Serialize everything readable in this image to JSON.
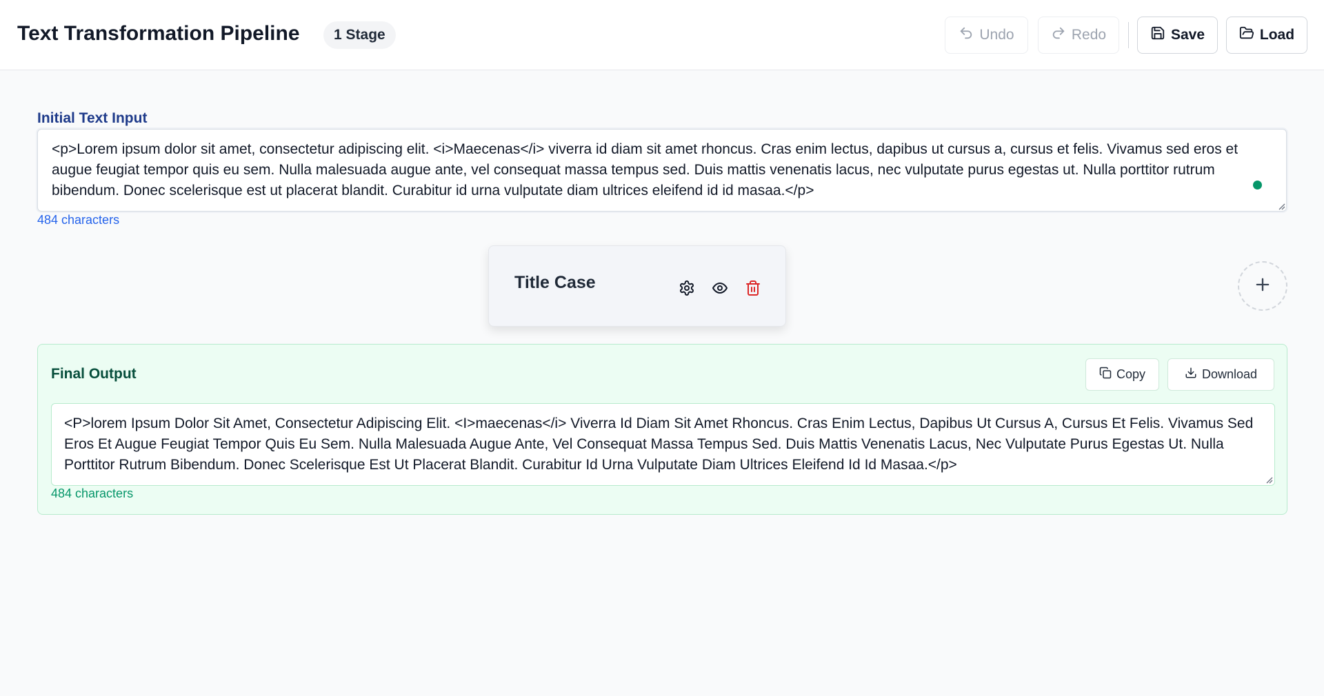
{
  "header": {
    "title": "Text Transformation Pipeline",
    "stage_badge": "1 Stage",
    "undo_label": "Undo",
    "redo_label": "Redo",
    "save_label": "Save",
    "load_label": "Load"
  },
  "input": {
    "label": "Initial Text Input",
    "value": "<p>Lorem ipsum dolor sit amet, consectetur adipiscing elit. <i>Maecenas</i> viverra id diam sit amet rhoncus. Cras enim lectus, dapibus ut cursus a, cursus et felis. Vivamus sed eros et augue feugiat tempor quis eu sem. Nulla malesuada augue ante, vel consequat massa tempus sed. Duis mattis venenatis lacus, nec vulputate purus egestas ut. Nulla porttitor rutrum bibendum. Donec scelerisque est ut placerat blandit. Curabitur id urna vulputate diam ultrices eleifend id id masaa.</p>",
    "char_count": "484 characters"
  },
  "stages": [
    {
      "title": "Title Case",
      "icons": [
        "gear-icon",
        "eye-icon",
        "trash-icon"
      ]
    }
  ],
  "output": {
    "title": "Final Output",
    "copy_label": "Copy",
    "download_label": "Download",
    "value": "<P>lorem Ipsum Dolor Sit Amet, Consectetur Adipiscing Elit. <I>maecenas</i> Viverra Id Diam Sit Amet Rhoncus. Cras Enim Lectus, Dapibus Ut Cursus A, Cursus Et Felis. Vivamus Sed Eros Et Augue Feugiat Tempor Quis Eu Sem. Nulla Malesuada Augue Ante, Vel Consequat Massa Tempus Sed. Duis Mattis Venenatis Lacus, Nec Vulputate Purus Egestas Ut. Nulla Porttitor Rutrum Bibendum. Donec Scelerisque Est Ut Placerat Blandit. Curabitur Id Urna Vulputate Diam Ultrices Eleifend Id Id Masaa.</p>",
    "char_count": "484 characters"
  },
  "colors": {
    "input_label": "#1e3a8a",
    "input_count": "#2563eb",
    "output_bg": "#ecfdf3",
    "output_title": "#064e3b",
    "output_count": "#059669",
    "delete": "#dc2626"
  }
}
